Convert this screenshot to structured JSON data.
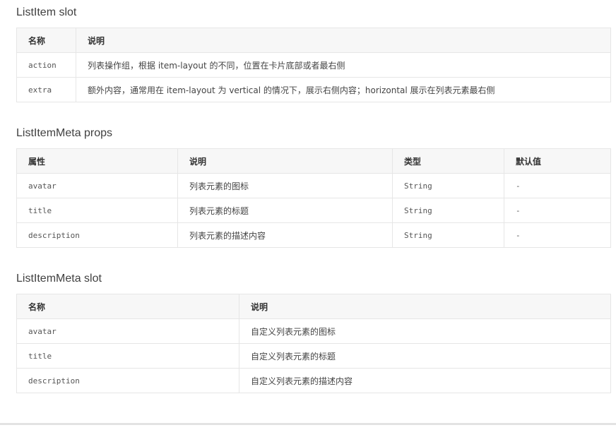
{
  "sections": [
    {
      "title": "ListItem slot",
      "headers": [
        "名称",
        "说明"
      ],
      "rows": [
        [
          "action",
          "列表操作组，根据 item-layout 的不同，位置在卡片底部或者最右侧"
        ],
        [
          "extra",
          "额外内容，通常用在 item-layout 为 vertical 的情况下，展示右侧内容；horizontal 展示在列表元素最右侧"
        ]
      ]
    },
    {
      "title": "ListItemMeta props",
      "headers": [
        "属性",
        "说明",
        "类型",
        "默认值"
      ],
      "rows": [
        [
          "avatar",
          "列表元素的图标",
          "String",
          "-"
        ],
        [
          "title",
          "列表元素的标题",
          "String",
          "-"
        ],
        [
          "description",
          "列表元素的描述内容",
          "String",
          "-"
        ]
      ]
    },
    {
      "title": "ListItemMeta slot",
      "headers": [
        "名称",
        "说明"
      ],
      "rows": [
        [
          "avatar",
          "自定义列表元素的图标"
        ],
        [
          "title",
          "自定义列表元素的标题"
        ],
        [
          "description",
          "自定义列表元素的描述内容"
        ]
      ]
    }
  ]
}
